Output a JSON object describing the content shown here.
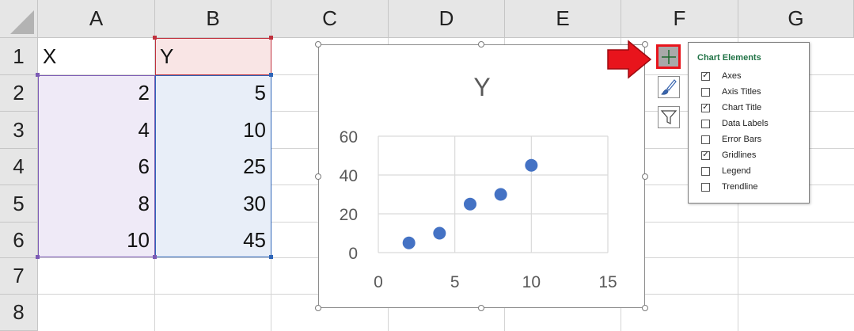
{
  "columns": [
    "A",
    "B",
    "C",
    "D",
    "E",
    "F",
    "G"
  ],
  "rows": [
    "1",
    "2",
    "3",
    "4",
    "5",
    "6",
    "7",
    "8"
  ],
  "cells": {
    "A1": "X",
    "B1": "Y",
    "A2": "2",
    "B2": "5",
    "A3": "4",
    "B3": "10",
    "A4": "6",
    "B4": "25",
    "A5": "8",
    "B5": "30",
    "A6": "10",
    "B6": "45"
  },
  "colors": {
    "x_range_fill": "#efeaf7",
    "x_range_border": "#7c5bb5",
    "y_range_fill": "#e8eef8",
    "y_range_border": "#2e65b8",
    "header_fill": "#f9e5e5",
    "header_border": "#c0313d",
    "marker": "#4472c4",
    "highlight_arrow": "#e8141c",
    "panel_title": "#217346"
  },
  "chart_data": {
    "type": "scatter",
    "title": "Y",
    "x": [
      2,
      4,
      6,
      8,
      10
    ],
    "y": [
      5,
      10,
      25,
      30,
      45
    ],
    "xlim": [
      0,
      15
    ],
    "ylim": [
      0,
      60
    ],
    "xticks": [
      "0",
      "5",
      "10",
      "15"
    ],
    "yticks": [
      "0",
      "20",
      "40",
      "60"
    ],
    "grid": true,
    "legend": "none"
  },
  "side_buttons": {
    "elements": "plus-icon",
    "styles": "paintbrush-icon",
    "filters": "funnel-icon"
  },
  "chart_elements_panel": {
    "title": "Chart Elements",
    "options": [
      {
        "label": "Axes",
        "checked": true
      },
      {
        "label": "Axis Titles",
        "checked": false
      },
      {
        "label": "Chart Title",
        "checked": true
      },
      {
        "label": "Data Labels",
        "checked": false
      },
      {
        "label": "Error Bars",
        "checked": false
      },
      {
        "label": "Gridlines",
        "checked": true
      },
      {
        "label": "Legend",
        "checked": false
      },
      {
        "label": "Trendline",
        "checked": false
      }
    ]
  }
}
